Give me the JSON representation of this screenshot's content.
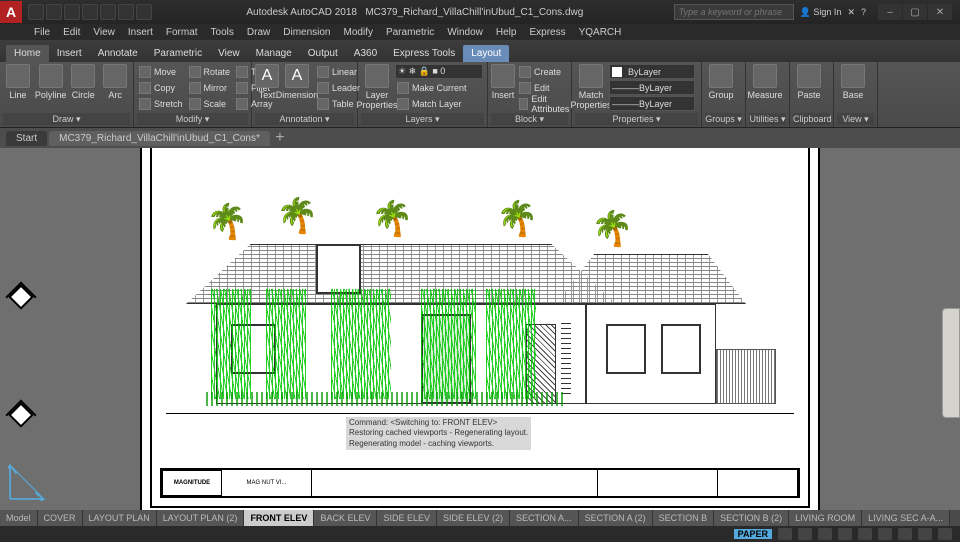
{
  "app": {
    "title": "Autodesk AutoCAD 2018",
    "document": "MC379_Richard_VillaChill'inUbud_C1_Cons.dwg"
  },
  "search": {
    "placeholder": "Type a keyword or phrase"
  },
  "sign_in": "Sign In",
  "menus": [
    "File",
    "Edit",
    "View",
    "Insert",
    "Format",
    "Tools",
    "Draw",
    "Dimension",
    "Modify",
    "Parametric",
    "Window",
    "Help",
    "Express",
    "YQARCH"
  ],
  "ribbon_tabs": [
    "Home",
    "Insert",
    "Annotate",
    "Parametric",
    "View",
    "Manage",
    "Output",
    "A360",
    "Express Tools",
    "Layout"
  ],
  "active_ribbon_tab": "Layout",
  "ribbon": {
    "draw": {
      "title": "Draw ▾",
      "big": [
        "Line",
        "Polyline",
        "Circle",
        "Arc"
      ]
    },
    "modify": {
      "title": "Modify ▾",
      "rows": [
        [
          "Move",
          "Rotate",
          "Trim"
        ],
        [
          "Copy",
          "Mirror",
          "Fillet"
        ],
        [
          "Stretch",
          "Scale",
          "Array"
        ]
      ]
    },
    "annotation": {
      "title": "Annotation ▾",
      "big": [
        "Text",
        "Dimension"
      ],
      "rows": [
        [
          "Linear"
        ],
        [
          "Leader"
        ],
        [
          "Table"
        ]
      ]
    },
    "layers": {
      "title": "Layers ▾",
      "big": "Layer\nProperties",
      "rows": [
        [
          "Make Current"
        ],
        [
          "Match Layer"
        ]
      ],
      "combo": "☀ ❄ 🔒 ■ 0"
    },
    "block": {
      "title": "Block ▾",
      "big": "Insert",
      "rows": [
        [
          "Create"
        ],
        [
          "Edit"
        ],
        [
          "Edit Attributes"
        ]
      ]
    },
    "matchprops": {
      "title": "Properties ▾",
      "big": "Match\nProperties",
      "combo1": "ByLayer",
      "combo2": "———ByLayer",
      "combo3": "———ByLayer"
    },
    "groups": {
      "title": "Groups ▾",
      "big": "Group"
    },
    "utilities": {
      "title": "Utilities ▾",
      "big": "Measure"
    },
    "clipboard": {
      "title": "Clipboard",
      "big": "Paste"
    },
    "view": {
      "title": "View ▾",
      "big": "Base"
    }
  },
  "doc_tabs": {
    "start": "Start",
    "file": "MC379_Richard_VillaChill'inUbud_C1_Cons*"
  },
  "layout_tabs": [
    "Model",
    "COVER",
    "LAYOUT PLAN",
    "LAYOUT PLAN (2)",
    "FRONT ELEV",
    "BACK ELEV",
    "SIDE ELEV",
    "SIDE ELEV (2)",
    "SECTION A...",
    "SECTION A (2)",
    "SECTION B",
    "SECTION B (2)",
    "LIVING ROOM",
    "LIVING SEC A-A..."
  ],
  "active_layout": "FRONT ELEV",
  "status": {
    "space": "PAPER"
  },
  "title_block": {
    "company": "MAGNITUDE",
    "project": "MAG NUT VI..."
  },
  "command_lines": [
    "Command:   <Switching to: FRONT ELEV>",
    "Restoring cached viewports - Regenerating layout.",
    "Regenerating model - caching viewports."
  ],
  "colors": {
    "accent": "#6a8cb8",
    "plant": "#00aa00"
  }
}
